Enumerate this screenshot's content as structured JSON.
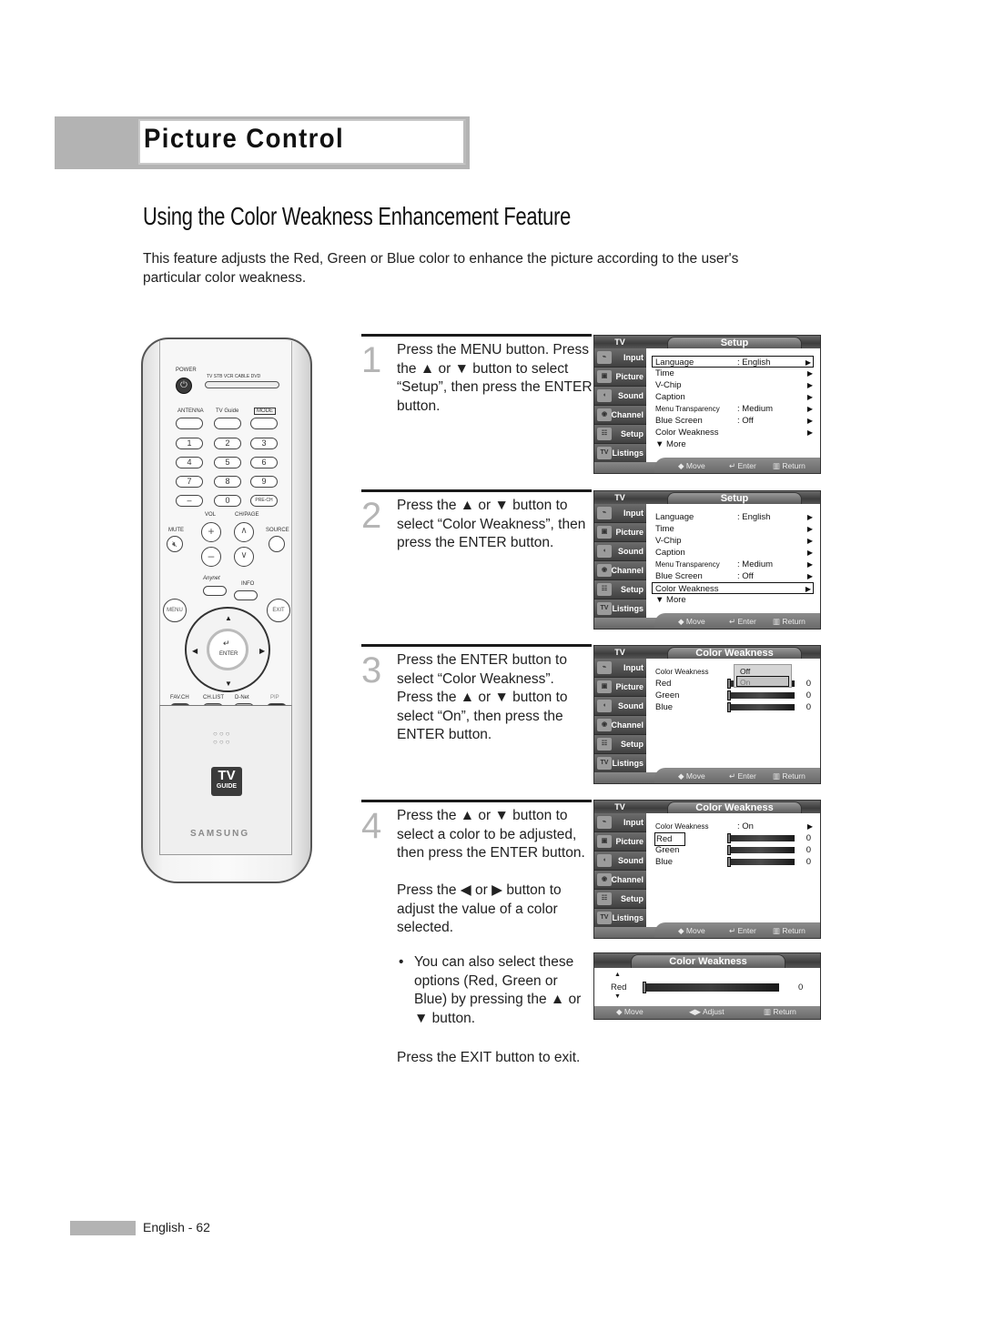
{
  "section": {
    "title": "Picture Control"
  },
  "heading": "Using the Color Weakness Enhancement Feature",
  "intro": "This feature adjusts the Red, Green or Blue color to enhance the picture according to the user's particular color weakness.",
  "remote": {
    "power_label": "POWER",
    "mode_labels": "TV  STB  VCR  CABLE  DVD",
    "top_buttons": [
      "ANTENNA",
      "TV Guide",
      "MODE"
    ],
    "number_keys": [
      "1",
      "2",
      "3",
      "4",
      "5",
      "6",
      "7",
      "8",
      "9",
      "–",
      "0",
      "PRE-CH"
    ],
    "vol_label": "VOL",
    "ch_label": "CH/PAGE",
    "mute_label": "MUTE",
    "source_label": "SOURCE",
    "anynet_label": "Anynet",
    "info_label": "INFO",
    "menu_label": "MENU",
    "exit_label": "EXIT",
    "enter_label": "ENTER",
    "color_keys": [
      "FAV.CH",
      "CH.LIST",
      "D-Net",
      "PIP"
    ],
    "tvguide_top": "TV",
    "tvguide_bottom": "GUIDE",
    "brand": "SAMSUNG"
  },
  "steps": [
    {
      "number": "1",
      "text": "Press the MENU button. Press the ▲ or ▼ button to select “Setup”, then press the ENTER button."
    },
    {
      "number": "2",
      "text": "Press the ▲ or ▼ button to select “Color Weakness”, then press the ENTER button."
    },
    {
      "number": "3",
      "text": "Press the ENTER button to select “Color Weakness”. Press the ▲ or ▼ button to select “On”, then press the ENTER button."
    },
    {
      "number": "4",
      "text": "Press the ▲ or ▼ button to select a color to be adjusted, then press the ENTER button.",
      "extra": "Press the ◀ or ▶ button to adjust the value of a color selected.",
      "bullet": "You can also select these options (Red, Green or Blue) by pressing the ▲ or ▼ button.",
      "exit": "Press the EXIT button to exit."
    }
  ],
  "osd": {
    "tv_label": "TV",
    "sidebar": [
      "Input",
      "Picture",
      "Sound",
      "Channel",
      "Setup",
      "Listings"
    ],
    "hints": {
      "move": "◆ Move",
      "enter": "↵ Enter",
      "return": "▥ Return",
      "adjust": "◀▶ Adjust"
    },
    "setup_title": "Setup",
    "setup_rows": [
      {
        "label": "Language",
        "value": ": English",
        "arrow": "▶"
      },
      {
        "label": "Time",
        "value": "",
        "arrow": "▶"
      },
      {
        "label": "V-Chip",
        "value": "",
        "arrow": "▶"
      },
      {
        "label": "Caption",
        "value": "",
        "arrow": "▶"
      },
      {
        "label": "Menu Transparency",
        "value": ": Medium",
        "arrow": "▶"
      },
      {
        "label": "Blue Screen",
        "value": ": Off",
        "arrow": "▶"
      },
      {
        "label": "Color Weakness",
        "value": "",
        "arrow": "▶"
      },
      {
        "label": "▼ More",
        "value": "",
        "arrow": ""
      }
    ],
    "cw_title": "Color Weakness",
    "cw_label": "Color Weakness",
    "cw_options": [
      "Off",
      "On"
    ],
    "cw_value": ": On",
    "colors": [
      {
        "label": "Red",
        "value": "0"
      },
      {
        "label": "Green",
        "value": "0"
      },
      {
        "label": "Blue",
        "value": "0"
      }
    ],
    "adjust": {
      "label": "Red",
      "value": "0",
      "up": "▲",
      "down": "▼"
    }
  },
  "footer": {
    "page": "English - 62"
  }
}
